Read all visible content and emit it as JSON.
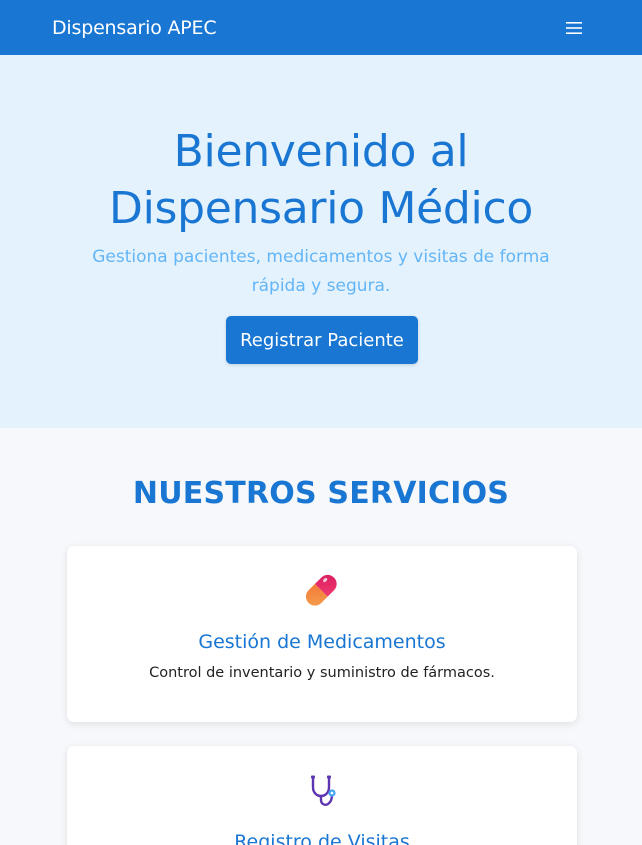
{
  "navbar": {
    "brand": "Dispensario APEC",
    "menu_icon": "hamburger-menu-icon"
  },
  "hero": {
    "title_line1": "Bienvenido al",
    "title_line2": "Dispensario Médico",
    "subtitle": "Gestiona pacientes, medicamentos y visitas de forma rápida y segura.",
    "cta_label": "Registrar Paciente"
  },
  "services": {
    "heading": "NUESTROS SERVICIOS",
    "cards": [
      {
        "icon": "pill-icon",
        "title": "Gestión de Medicamentos",
        "description": "Control de inventario y suministro de fármacos."
      },
      {
        "icon": "stethoscope-icon",
        "title": "Registro de Visitas",
        "description": ""
      }
    ]
  },
  "colors": {
    "primary": "#1976d2",
    "hero_bg": "#e3f2fd",
    "subtitle": "#64b5f6",
    "page_bg": "#f6f8fb"
  }
}
